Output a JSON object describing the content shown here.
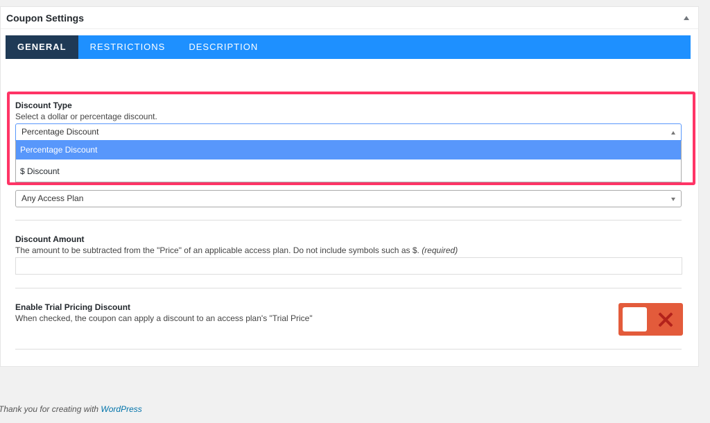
{
  "panel": {
    "title": "Coupon Settings"
  },
  "tabs": [
    {
      "label": "GENERAL"
    },
    {
      "label": "RESTRICTIONS"
    },
    {
      "label": "DESCRIPTION"
    }
  ],
  "discount_type": {
    "label": "Discount Type",
    "description": "Select a dollar or percentage discount.",
    "selected": "Percentage Discount",
    "options": [
      "Percentage Discount",
      "$ Discount"
    ]
  },
  "access_plan": {
    "selected": "Any Access Plan"
  },
  "discount_amount": {
    "label": "Discount Amount",
    "description": "The amount to be subtracted from the \"Price\" of an applicable access plan. Do not include symbols such as $.",
    "required": "(required)",
    "value": ""
  },
  "trial_pricing": {
    "label": "Enable Trial Pricing Discount",
    "description": "When checked, the coupon can apply a discount to an access plan's \"Trial Price\"",
    "toggle_state": "off"
  },
  "footer": {
    "text": "Thank you for creating with ",
    "link": "WordPress"
  },
  "colors": {
    "tab_bar": "#1e90ff",
    "active_tab": "#1f3a56",
    "highlight": "#ff3466",
    "toggle_off": "#e35b3b"
  }
}
